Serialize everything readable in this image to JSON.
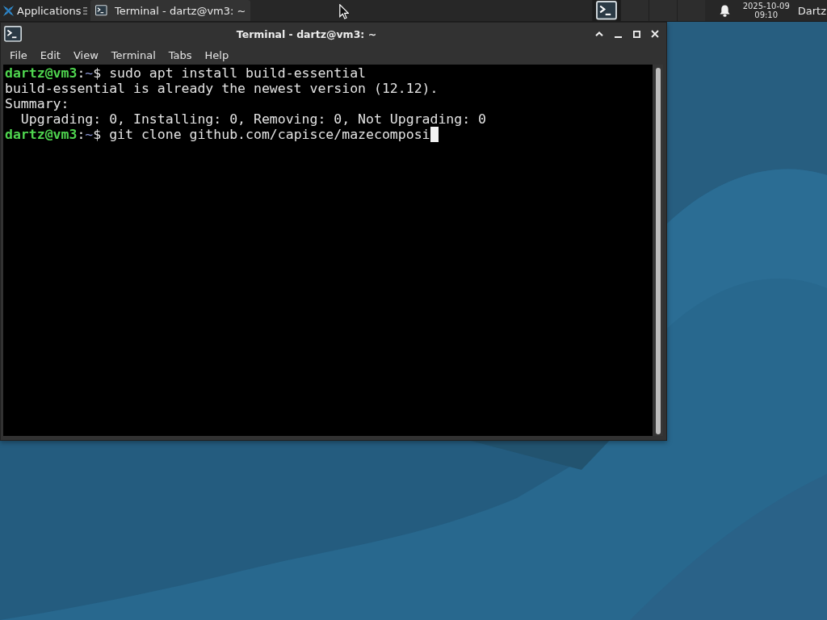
{
  "top_panel": {
    "app_menu": {
      "label": "Applications"
    },
    "taskbar": [
      {
        "label": "Terminal - dartz@vm3: ~",
        "selected": true
      }
    ],
    "workspaces": [
      {
        "selected": true
      },
      {
        "selected": false
      },
      {
        "selected": false
      },
      {
        "selected": false
      }
    ],
    "clock": {
      "date": "2025-10-09",
      "time": "09:10"
    },
    "user": "Dartz"
  },
  "window": {
    "title": "Terminal - dartz@vm3: ~",
    "menu": [
      "File",
      "Edit",
      "View",
      "Terminal",
      "Tabs",
      "Help"
    ],
    "terminal": {
      "cursor": true,
      "lines": [
        {
          "kind": "prompt",
          "user_host": "dartz@vm3",
          "separator": ":",
          "path": "~",
          "symbol": "$",
          "command": "sudo apt install build-essential"
        },
        {
          "kind": "output",
          "text": "build-essential is already the newest version (12.12)."
        },
        {
          "kind": "output",
          "text": "Summary:"
        },
        {
          "kind": "output",
          "text": "  Upgrading: 0, Installing: 0, Removing: 0, Not Upgrading: 0"
        },
        {
          "kind": "prompt",
          "user_host": "dartz@vm3",
          "separator": ":",
          "path": "~",
          "symbol": "$",
          "command": "git clone github.com/capisce/mazecomposi"
        }
      ]
    }
  }
}
